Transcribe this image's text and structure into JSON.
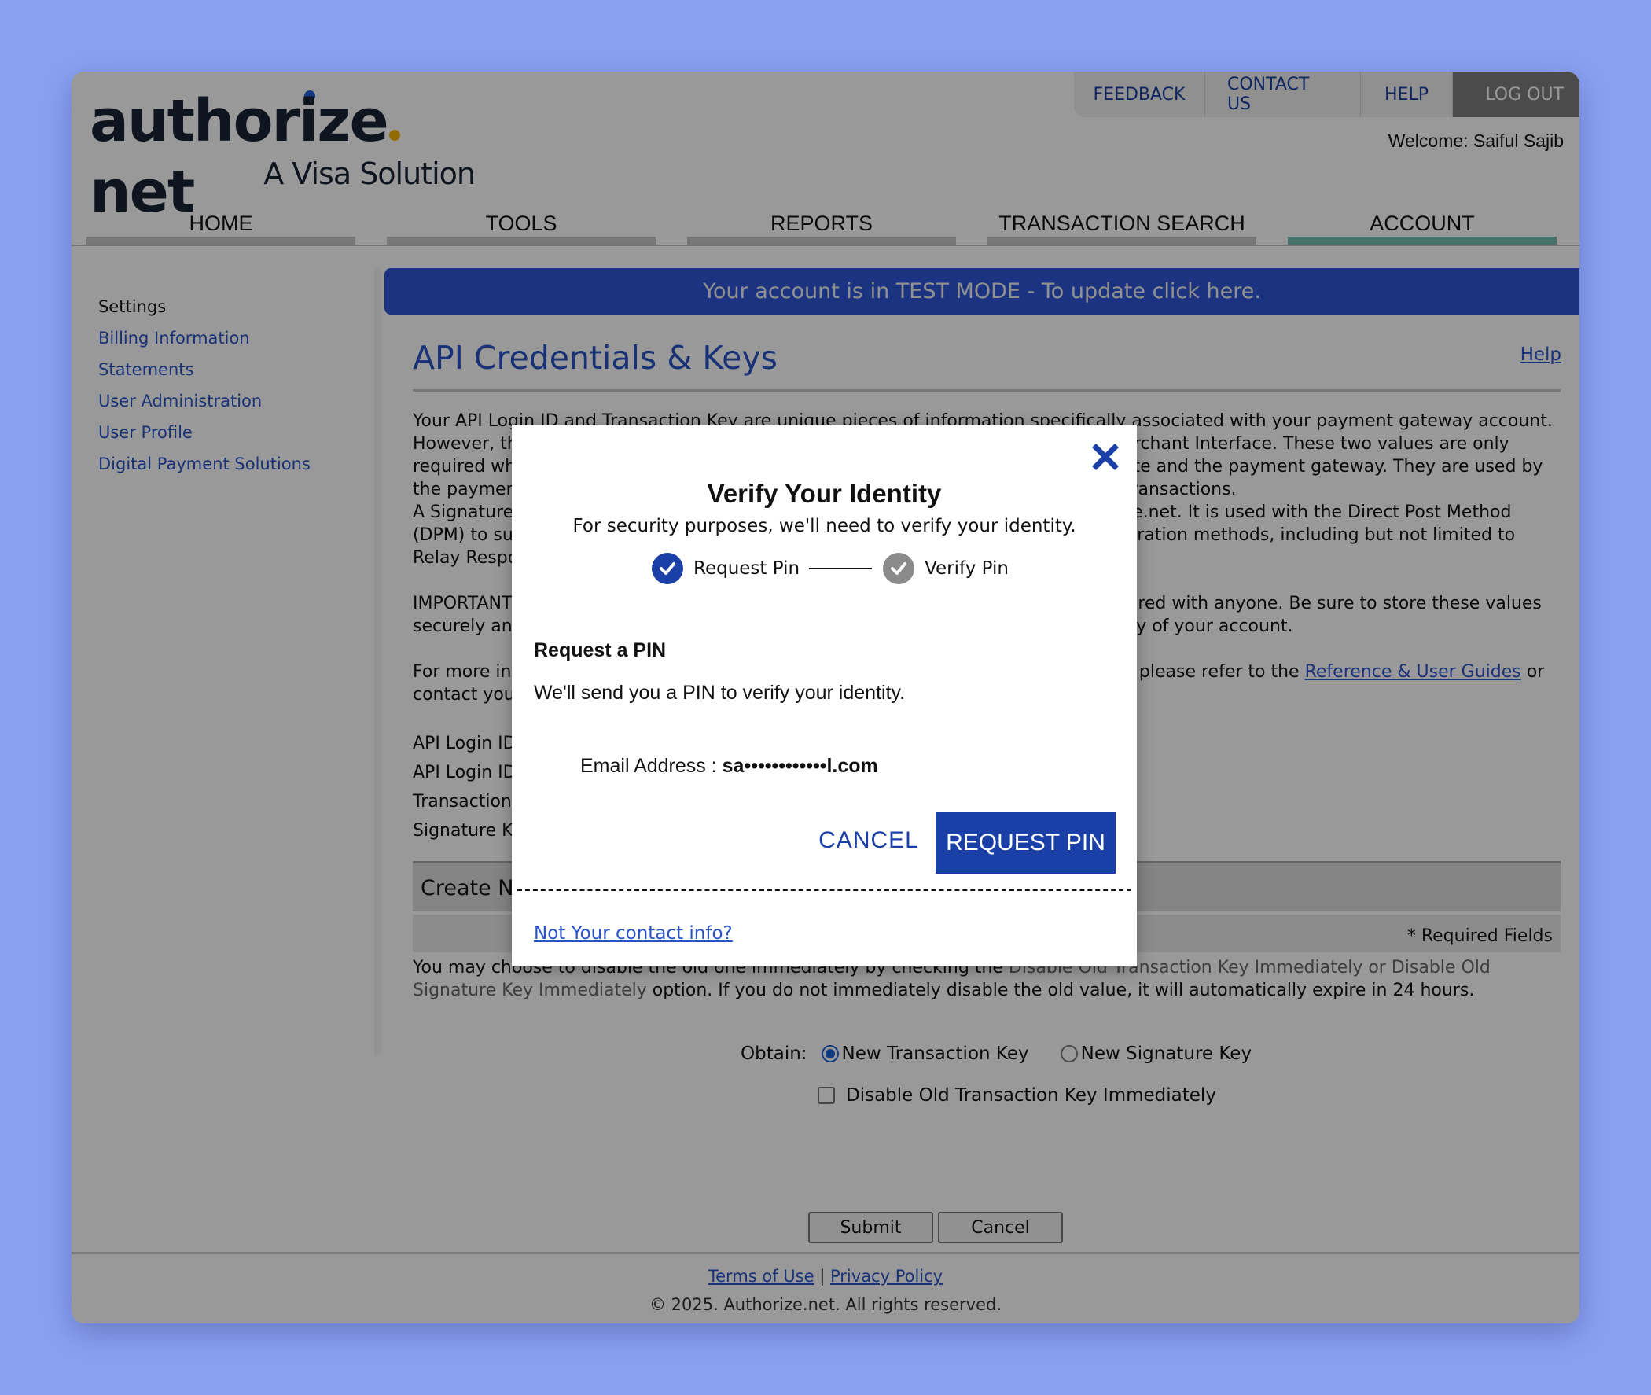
{
  "brand": {
    "name_part1": "authorize",
    "name_part2": "net",
    "tagline": "A Visa Solution",
    "colors": {
      "accent_blue": "#1a40a8",
      "link_blue": "#2952c7",
      "active_tab": "#7bbdb2",
      "banner": "#2d55d6",
      "page_bg": "#8aa1f1"
    }
  },
  "toplinks": {
    "feedback": "FEEDBACK",
    "contact": "CONTACT US",
    "help": "HELP",
    "logout": "LOG OUT"
  },
  "welcome": "Welcome: Saiful Sajib",
  "nav": {
    "tabs": [
      {
        "label": "HOME",
        "active": false
      },
      {
        "label": "TOOLS",
        "active": false
      },
      {
        "label": "REPORTS",
        "active": false
      },
      {
        "label": "TRANSACTION SEARCH",
        "active": false
      },
      {
        "label": "ACCOUNT",
        "active": true
      }
    ]
  },
  "sidebar": {
    "title": "Settings",
    "items": [
      {
        "label": "Billing Information"
      },
      {
        "label": "Statements"
      },
      {
        "label": "User Administration"
      },
      {
        "label": "User Profile"
      },
      {
        "label": "Digital Payment Solutions"
      }
    ]
  },
  "banner": "Your account is in TEST MODE - To update click here.",
  "main": {
    "title": "API Credentials & Keys",
    "help_link": "Help",
    "paragraph1": "Your API Login ID and Transaction Key are unique pieces of information specifically associated with your payment gateway account. However, the API Login ID and Transaction Key are not used for logging into the Merchant Interface. These two values are only required when setting up an Internet connection between your e-commerce Web site and the payment gateway. They are used by the payment gateway to authenticate that you are authorized to submit Web site transactions.",
    "paragraph2": "A Signature Key is used to verify that the transaction response came from Authorize.net. It is used with the Direct Post Method (DPM) to submit transactions, and it can be used to verify responses for other integration methods, including but not limited to Relay Response and Silent Post.",
    "paragraph3": "IMPORTANT: Your API Login ID, Transaction Key and Signature Key should not be shared with anyone. Be sure to store these values securely and change the Transaction Key regularly to further strengthen the security of your account.",
    "paragraph4_pre": "For more information on using the API Login ID, Transaction Key and Signature Key, please refer to the ",
    "paragraph4_link": "Reference & User Guides",
    "paragraph4_post": " or contact your Web developer.",
    "fields": [
      "API Login ID",
      "API Login ID",
      "Transaction Key",
      "Signature Key"
    ],
    "create_section": "Create New Key(s)",
    "required_note": "* Required Fields",
    "disable_note_pre": "You may choose to disable the old one immediately by checking the ",
    "disable_note_muted": "Disable Old Transaction Key Immediately or Disable Old Signature Key Immediately",
    "disable_note_post": " option. If you do not immediately disable the old value, it will automatically expire in 24 hours.",
    "obtain_label": "Obtain:",
    "obtain_options": [
      {
        "label": "New Transaction Key",
        "selected": true
      },
      {
        "label": "New Signature Key",
        "selected": false
      }
    ],
    "disable_checkbox": {
      "label": "Disable Old Transaction Key Immediately",
      "checked": false
    },
    "submit_label": "Submit",
    "cancel_label": "Cancel"
  },
  "footer": {
    "terms": "Terms of Use",
    "separator": "|",
    "privacy": "Privacy Policy",
    "copyright": "© 2025. Authorize.net. All rights reserved."
  },
  "modal": {
    "title": "Verify Your Identity",
    "subtitle": "For security purposes, we'll need to verify your identity.",
    "steps": [
      {
        "label": "Request Pin",
        "state": "active"
      },
      {
        "label": "Verify Pin",
        "state": "pending"
      }
    ],
    "section_title": "Request a PIN",
    "section_text": "We'll send you a PIN to verify your identity.",
    "email_label": "Email Address : ",
    "email_value": "sa••••••••••••l.com",
    "cancel_label": "CANCEL",
    "request_label": "REQUEST PIN",
    "not_you_link": "Not Your contact info?"
  }
}
